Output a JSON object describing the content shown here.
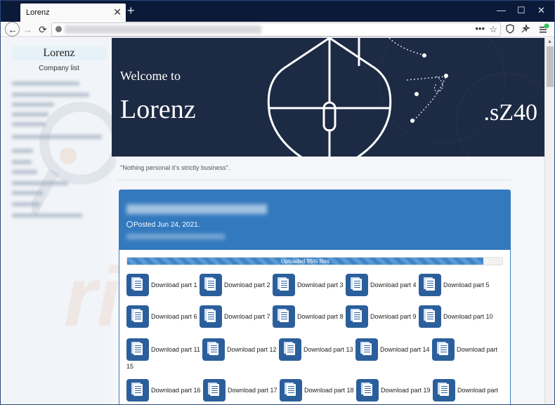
{
  "browser": {
    "tab_title": "Lorenz",
    "tab_close": "✕",
    "new_tab": "+",
    "minimize": "—",
    "maximize": "☐",
    "close": "✕"
  },
  "nav": {
    "back": "←",
    "forward": "→",
    "reload": "⟳",
    "page_actions": "•••",
    "bookmark": "☆"
  },
  "sidebar": {
    "brand": "Lorenz",
    "company_list": "Company list"
  },
  "banner": {
    "welcome": "Welcome to",
    "name": "Lorenz",
    "id": ".sZ40"
  },
  "quote": "\"Nothing personal it's strictly business\".",
  "post": {
    "posted": "Posted Jun 24, 2021.",
    "progress_label": "Uploaded 95% files",
    "progress_value": 0.95
  },
  "downloads": [
    "Download part 1",
    "Download part 2",
    "Download part 3",
    "Download part 4",
    "Download part 5",
    "Download part 6",
    "Download part 7",
    "Download part 8",
    "Download part 9",
    "Download part 10",
    "Download part 11",
    "Download part 12",
    "Download part 13",
    "Download part 14",
    "Download part",
    "Download part 16",
    "Download part 17",
    "Download part 18",
    "Download part 19",
    "Download part"
  ],
  "wrapped_number": "15",
  "colors": {
    "header_blue": "#3379be",
    "icon_blue": "#2b5f9c",
    "banner_navy": "#1d2a44"
  }
}
